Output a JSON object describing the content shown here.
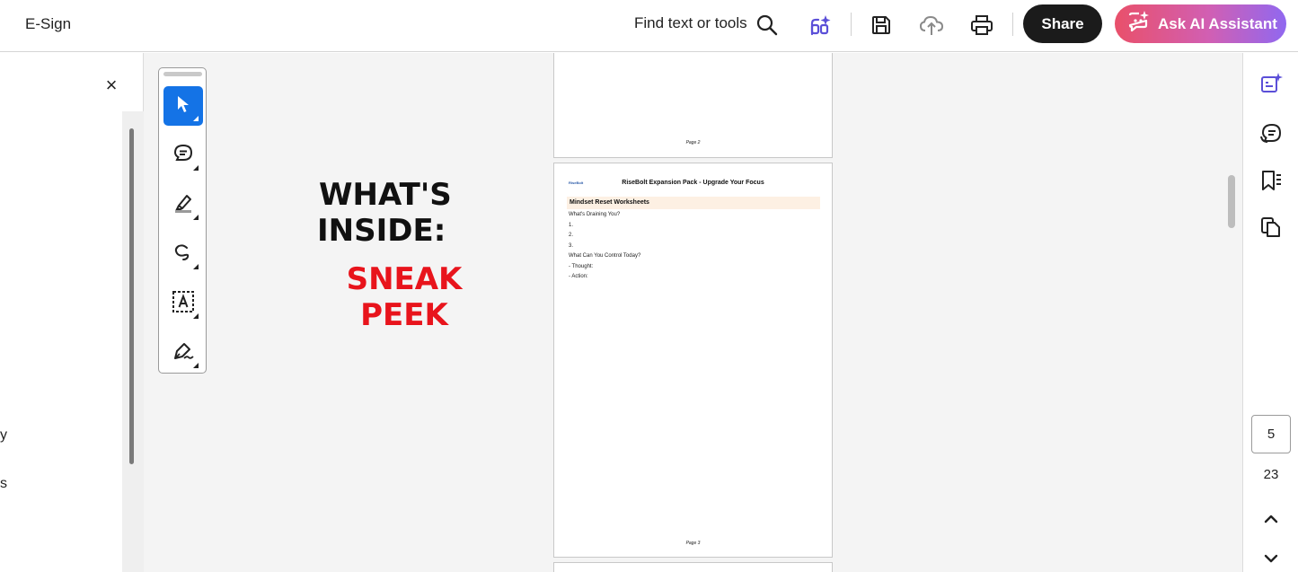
{
  "app": {
    "title": "E-Sign",
    "find_label": "Find text or tools",
    "share_label": "Share",
    "ai_label": "Ask AI Assistant",
    "accent_color": "#1473e6",
    "ai_gradient": [
      "#e9506a",
      "#9068f0"
    ]
  },
  "toolbar_icons": [
    "search-icon",
    "edit-ai-icon",
    "save-icon",
    "cloud-upload-icon",
    "print-icon"
  ],
  "left_panel": {
    "close_glyph": "×",
    "fragments": [
      "y",
      "s"
    ]
  },
  "tools": [
    {
      "name": "select-tool",
      "icon": "pointer-icon",
      "active": true
    },
    {
      "name": "comment-tool",
      "icon": "comment-icon",
      "active": false
    },
    {
      "name": "highlight-tool",
      "icon": "highlighter-icon",
      "active": false
    },
    {
      "name": "draw-tool",
      "icon": "freehand-icon",
      "active": false
    },
    {
      "name": "text-tool",
      "icon": "text-box-icon",
      "active": false
    },
    {
      "name": "sign-tool",
      "icon": "sign-pen-icon",
      "active": false
    }
  ],
  "document": {
    "headline_line1": "WHAT'S",
    "headline_line2": "INSIDE:",
    "sneak_line1": "SNEAK",
    "sneak_line2": "PEEK",
    "page2_footer": "Page 2",
    "page3": {
      "logo": "RiseBolt",
      "title": "RiseBolt Expansion Pack - Upgrade Your Focus",
      "section": "Mindset Reset Worksheets",
      "lines": [
        "What's Draining You?",
        "1.",
        "2.",
        "3.",
        "What Can You Control Today?",
        "- Thought:",
        "- Action:"
      ],
      "footer": "Page 3"
    }
  },
  "right_rail": {
    "icons": [
      "all-tools-icon",
      "comments-icon",
      "bookmarks-icon",
      "pages-icon"
    ],
    "current_page": "5",
    "total_pages": "23"
  }
}
